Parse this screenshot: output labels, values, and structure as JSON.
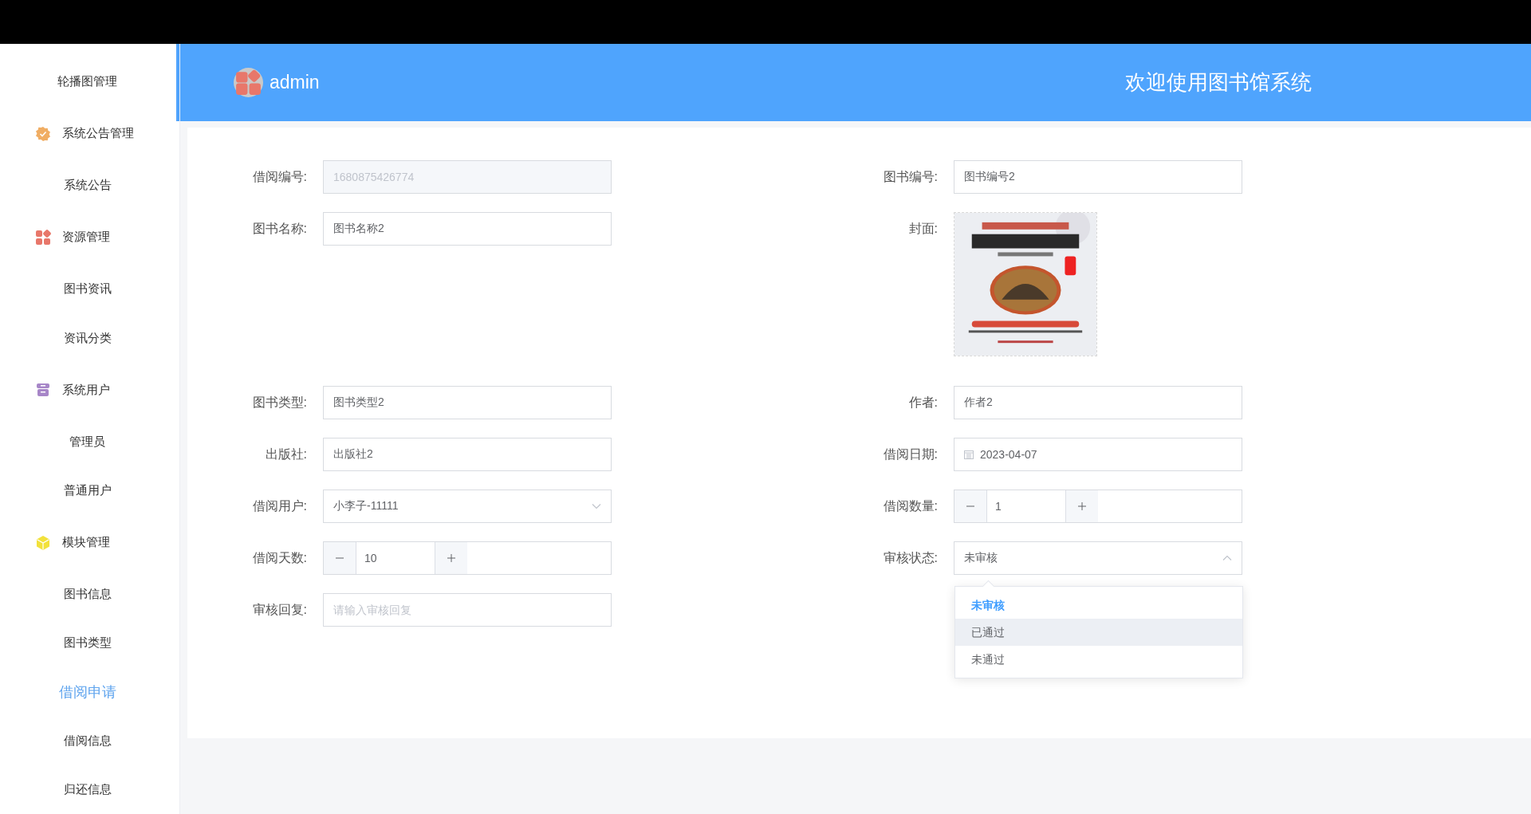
{
  "sidebar": {
    "items": [
      {
        "kind": "item",
        "label": "轮播图管理",
        "selected": false
      },
      {
        "kind": "group",
        "label": "系统公告管理",
        "color": "#f0ad63"
      },
      {
        "kind": "item",
        "label": "系统公告",
        "selected": false
      },
      {
        "kind": "group",
        "label": "资源管理",
        "color": "#e8776a"
      },
      {
        "kind": "item",
        "label": "图书资讯",
        "selected": false
      },
      {
        "kind": "item",
        "label": "资讯分类",
        "selected": false
      },
      {
        "kind": "group",
        "label": "系统用户",
        "color": "#a786c8"
      },
      {
        "kind": "item",
        "label": "管理员",
        "selected": false
      },
      {
        "kind": "item",
        "label": "普通用户",
        "selected": false
      },
      {
        "kind": "group",
        "label": "模块管理",
        "color": "#f2e13b"
      },
      {
        "kind": "item",
        "label": "图书信息",
        "selected": false
      },
      {
        "kind": "item",
        "label": "图书类型",
        "selected": false
      },
      {
        "kind": "item",
        "label": "借阅申请",
        "selected": true
      },
      {
        "kind": "item",
        "label": "借阅信息",
        "selected": false
      },
      {
        "kind": "item",
        "label": "归还信息",
        "selected": false
      }
    ]
  },
  "header": {
    "user": "admin",
    "title": "欢迎使用图书馆系统"
  },
  "form": {
    "rows": [
      {
        "left": {
          "label": "借阅编号:",
          "kind": "text",
          "value": "1680875426774",
          "disabled": true
        },
        "right": {
          "label": "图书编号:",
          "kind": "text",
          "value": "图书编号2",
          "disabled": false
        }
      },
      {
        "left": {
          "label": "图书名称:",
          "kind": "text",
          "value": "图书名称2",
          "disabled": false
        },
        "right": {
          "label": "封面:",
          "kind": "picture"
        }
      },
      {
        "left": {
          "label": "图书类型:",
          "kind": "text",
          "value": "图书类型2",
          "disabled": false
        },
        "right": {
          "label": "作者:",
          "kind": "text",
          "value": "作者2",
          "disabled": false
        }
      },
      {
        "left": {
          "label": "出版社:",
          "kind": "text",
          "value": "出版社2",
          "disabled": false
        },
        "right": {
          "label": "借阅日期:",
          "kind": "date",
          "value": "2023-04-07"
        }
      },
      {
        "left": {
          "label": "借阅用户:",
          "kind": "select",
          "value": "小李子-11111",
          "expanded": false
        },
        "right": {
          "label": "借阅数量:",
          "kind": "number",
          "value": "1"
        }
      },
      {
        "left": {
          "label": "借阅天数:",
          "kind": "number",
          "value": "10"
        },
        "right": {
          "label": "审核状态:",
          "kind": "select",
          "value": "未审核",
          "expanded": true,
          "options": [
            {
              "label": "未审核",
              "selected": true,
              "hovered": false
            },
            {
              "label": "已通过",
              "selected": false,
              "hovered": true
            },
            {
              "label": "未通过",
              "selected": false,
              "hovered": false
            }
          ]
        }
      },
      {
        "left": {
          "label": "审核回复:",
          "kind": "text",
          "placeholder": "请输入审核回复"
        }
      }
    ]
  }
}
